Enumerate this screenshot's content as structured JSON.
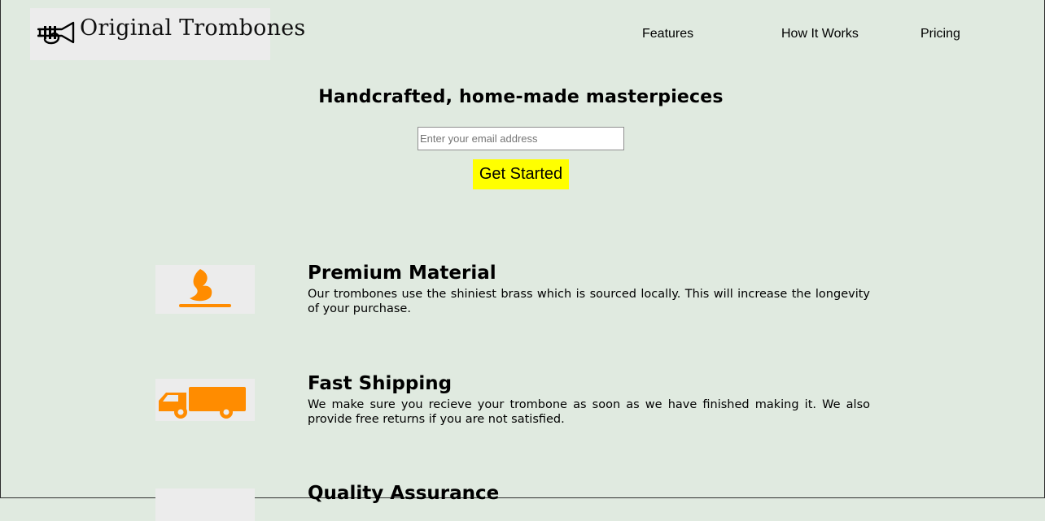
{
  "header": {
    "logo_text": "Original Trombones",
    "logo_icon": "trumpet-icon",
    "nav": [
      {
        "label": "Features"
      },
      {
        "label": "How It Works"
      },
      {
        "label": "Pricing"
      }
    ]
  },
  "hero": {
    "title": "Handcrafted, home-made masterpieces",
    "email_placeholder": "Enter your email address",
    "email_value": "",
    "cta_label": "Get Started"
  },
  "features": [
    {
      "icon": "fire-icon",
      "title": "Premium Material",
      "description": "Our trombones use the shiniest brass which is sourced locally. This will increase the longevity of your purchase."
    },
    {
      "icon": "truck-icon",
      "title": "Fast Shipping",
      "description": "We make sure you recieve your trombone as soon as we have finished making it. We also provide free returns if you are not satisfied."
    },
    {
      "icon": "check-icon",
      "title": "Quality Assurance",
      "description": ""
    }
  ],
  "colors": {
    "background": "#e0eae0",
    "cta": "#ffff00",
    "icon_accent": "#ff8c00",
    "logo_bg": "#ececec"
  }
}
